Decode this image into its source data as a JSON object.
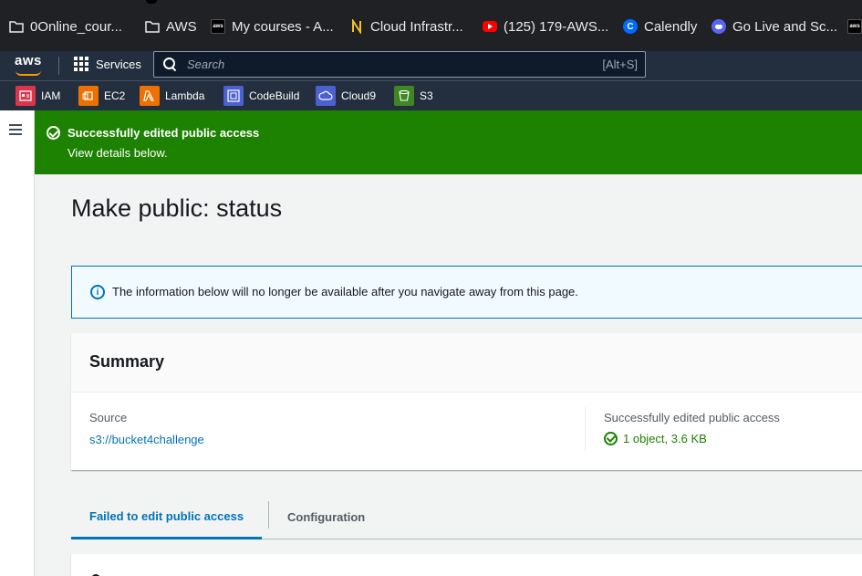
{
  "bookmarks": [
    {
      "label": "0Online_cour...",
      "icon": "folder-icon"
    },
    {
      "label": "AWS",
      "icon": "folder-icon"
    },
    {
      "label": "My courses - A...",
      "icon": "aws-favicon"
    },
    {
      "label": "Cloud Infrastr...",
      "icon": "n-favicon"
    },
    {
      "label": "(125) 179-AWS...",
      "icon": "youtube-icon"
    },
    {
      "label": "Calendly",
      "icon": "calendly-icon"
    },
    {
      "label": "Go Live and Sc...",
      "icon": "discord-icon"
    }
  ],
  "nav": {
    "logo": "aws",
    "services": "Services",
    "search_placeholder": "Search",
    "search_shortcut": "[Alt+S]"
  },
  "favorites": [
    {
      "label": "IAM",
      "color": "#dd344c"
    },
    {
      "label": "EC2",
      "color": "#ed7100"
    },
    {
      "label": "Lambda",
      "color": "#ed7100"
    },
    {
      "label": "CodeBuild",
      "color": "#4b61d1"
    },
    {
      "label": "Cloud9",
      "color": "#4b61d1"
    },
    {
      "label": "S3",
      "color": "#3f8624"
    }
  ],
  "flash": {
    "title": "Successfully edited public access",
    "subtitle": "View details below.",
    "color": "#1d8102"
  },
  "page": {
    "title": "Make public: status",
    "info": "The information below will no longer be available after you navigate away from this page."
  },
  "summary": {
    "heading": "Summary",
    "source_label": "Source",
    "source_value": "s3://bucket4challenge",
    "status_label": "Successfully edited public access",
    "status_value": "1 object, 3.6 KB"
  },
  "tabs": [
    {
      "label": "Failed to edit public access",
      "active": true
    },
    {
      "label": "Configuration",
      "active": false
    }
  ]
}
